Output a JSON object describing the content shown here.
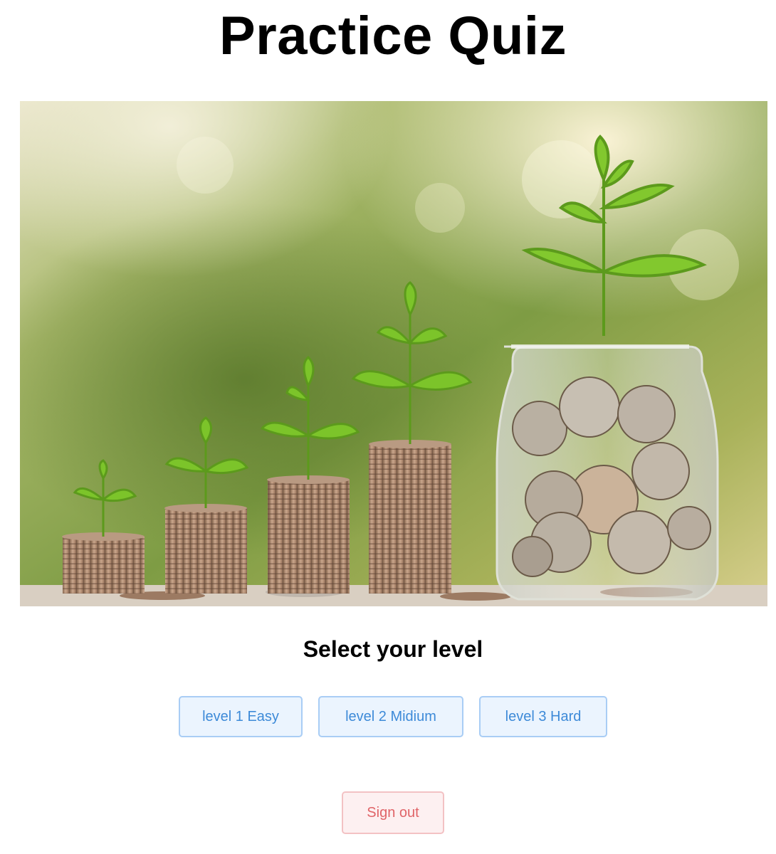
{
  "page": {
    "title": "Practice Quiz",
    "hero_image": "coin-stacks-with-plant-sprouts"
  },
  "level_select": {
    "heading": "Select your level",
    "levels": [
      {
        "label": "level 1 Easy"
      },
      {
        "label": "level 2 Midium"
      },
      {
        "label": "level 3 Hard"
      }
    ]
  },
  "actions": {
    "sign_out_label": "Sign out"
  },
  "colors": {
    "level_button_text": "#3d8ad8",
    "level_button_bg": "#ebf4fe",
    "level_button_border": "#a9cdf5",
    "signout_text": "#e06468",
    "signout_bg": "#fdf0f1",
    "signout_border": "#f3c2c4"
  }
}
